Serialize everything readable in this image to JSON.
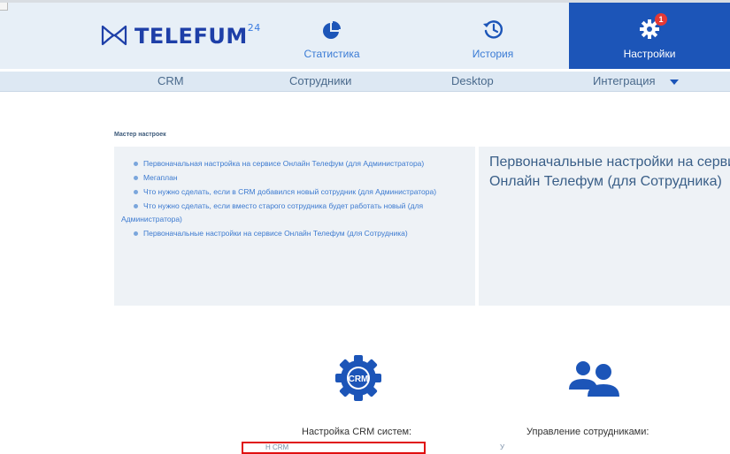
{
  "app": {
    "logo_text": "TELEFUM",
    "logo_suffix": "24"
  },
  "nav": {
    "tabs": [
      {
        "label": "Статистика",
        "icon": "pie-chart-icon"
      },
      {
        "label": "История",
        "icon": "history-icon"
      },
      {
        "label": "Настройки",
        "icon": "gear-icon",
        "active": true,
        "badge": "1"
      }
    ]
  },
  "subnav": {
    "items": [
      "CRM",
      "Сотрудники",
      "Desktop",
      "Интеграция"
    ]
  },
  "wizard": {
    "title": "Мастер настроек",
    "items": [
      "Первоначальная настройка на сервисе Онлайн Телефум (для Администратора)",
      "Мегаплан",
      "Что нужно сделать, если в CRM добавился новый сотрудник (для Администратора)",
      "Что нужно сделать, если вместо старого сотрудника будет работать новый (для Администратора)",
      "Первоначальные настройки на сервисе Онлайн Телефум (для Сотрудника)"
    ],
    "detail_heading": "Первоначальные настройки на сервисе Онлайн Телефум (для Сотрудника)"
  },
  "features": [
    {
      "label": "Настройка CRM систем:",
      "icon": "crm-gear-icon",
      "icon_text": "CRM",
      "partial_text": "Н                                    CRM"
    },
    {
      "label": "Управление сотрудниками:",
      "icon": "users-icon",
      "partial_text": "У"
    }
  ],
  "colors": {
    "accent": "#1c55b8",
    "link": "#3c7ad0",
    "badge": "#e53935",
    "highlight_box": "#e01010"
  }
}
